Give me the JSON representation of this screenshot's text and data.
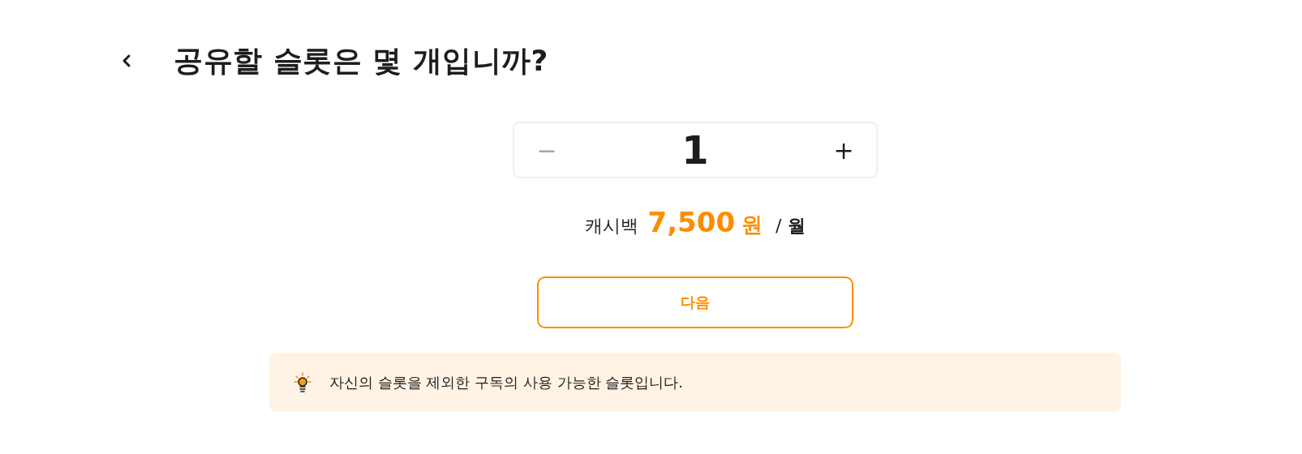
{
  "header": {
    "title": "공유할 슬롯은 몇 개입니까?"
  },
  "stepper": {
    "value": "1",
    "decrease_label": "−",
    "increase_label": "+",
    "decrease_disabled": true,
    "increase_disabled": false
  },
  "cashback": {
    "label": "캐시백",
    "amount": "7,500",
    "unit": "원",
    "separator": "/",
    "period": "월"
  },
  "next_button": {
    "label": "다음"
  },
  "tip": {
    "text": "자신의 슬롯을 제외한 구독의 사용 가능한 슬롯입니다."
  }
}
